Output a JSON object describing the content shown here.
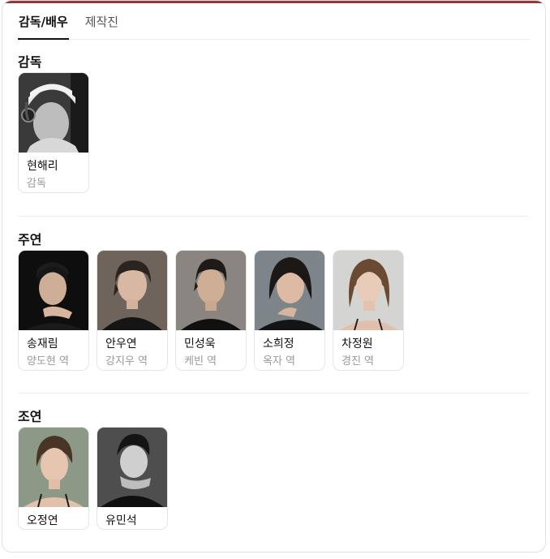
{
  "tabs": [
    {
      "label": "감독/배우",
      "active": true
    },
    {
      "label": "제작진",
      "active": false
    }
  ],
  "sections": [
    {
      "title": "감독",
      "people": [
        {
          "name": "현해리",
          "role": "감독",
          "photo": "director-portrait"
        }
      ]
    },
    {
      "title": "주연",
      "people": [
        {
          "name": "송재림",
          "role": "양도현 역",
          "photo": "actor-portrait"
        },
        {
          "name": "안우연",
          "role": "강지우 역",
          "photo": "actor-portrait"
        },
        {
          "name": "민성욱",
          "role": "케빈 역",
          "photo": "actor-portrait"
        },
        {
          "name": "소희정",
          "role": "옥자 역",
          "photo": "actress-portrait"
        },
        {
          "name": "차정원",
          "role": "경진 역",
          "photo": "actress-portrait"
        }
      ]
    },
    {
      "title": "조연",
      "people": [
        {
          "name": "오정연",
          "role": "",
          "photo": "actress-portrait"
        },
        {
          "name": "유민석",
          "role": "",
          "photo": "actor-portrait"
        }
      ]
    }
  ],
  "colors": {
    "accent_top_bar": "#8f3b3c",
    "text_primary": "#111111",
    "text_secondary": "#999999"
  }
}
